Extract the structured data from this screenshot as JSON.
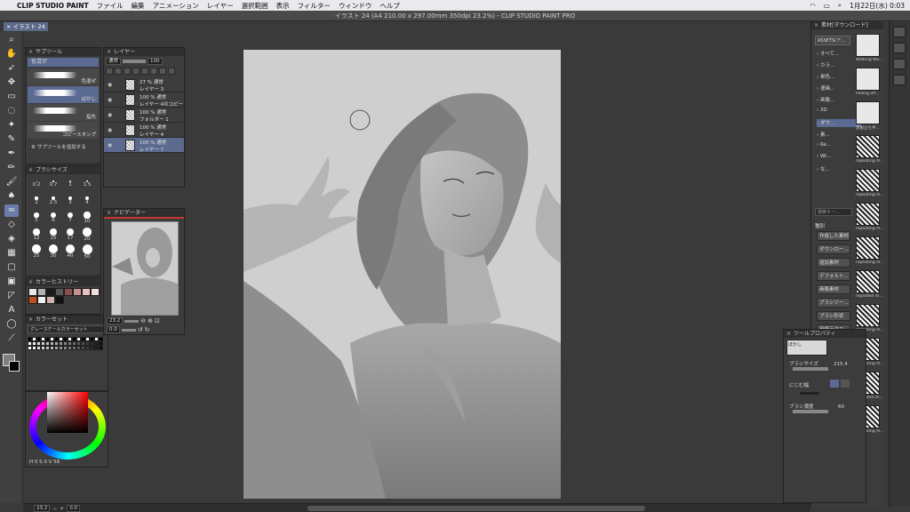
{
  "menubar": {
    "app_name": "CLIP STUDIO PAINT",
    "items": [
      "ファイル",
      "編集",
      "アニメーション",
      "レイヤー",
      "選択範囲",
      "表示",
      "フィルター",
      "ウィンドウ",
      "ヘルプ"
    ],
    "clock": "1月22日(水) 0:03"
  },
  "window": {
    "title": "イラスト 24 (A4 210.00 x 297.00mm 350dpi 23.2%) - CLIP STUDIO PAINT PRO",
    "canvas_tab": "イラスト 24"
  },
  "subtool_panel": {
    "title": "サブツール",
    "tab": "色混ぜ",
    "items": [
      "色混ぜ",
      "ぼかし",
      "指先",
      "コピースタンプ"
    ],
    "add_button": "サブツールを追加する"
  },
  "brushsize_panel": {
    "title": "ブラシサイズ",
    "sizes": [
      "0.2",
      "0.7",
      "1",
      "1.5",
      "2",
      "2.5",
      "3",
      "4",
      "5",
      "6",
      "7",
      "10",
      "12",
      "15",
      "17",
      "20",
      "25",
      "30",
      "40",
      "50"
    ]
  },
  "layer_panel": {
    "title": "レイヤー",
    "blend_mode": "通常",
    "opacity": "100",
    "layers": [
      {
        "mode": "27 % 通常",
        "name": "レイヤー 3"
      },
      {
        "mode": "100 % 通常",
        "name": "レイヤー 4のコピー"
      },
      {
        "mode": "100 % 通常",
        "name": "フォルダー 1"
      },
      {
        "mode": "100 % 通常",
        "name": "レイヤー 4"
      },
      {
        "mode": "100 % 通常",
        "name": "レイヤー 7"
      }
    ]
  },
  "navigator_panel": {
    "title": "ナビゲーター",
    "zoom": "23.2",
    "rotation": "0.0"
  },
  "colorhistory_panel": {
    "title": "カラーヒストリー",
    "colors": [
      "#e8e8e8",
      "#b0b0b0",
      "#1a1a1a",
      "#5a5a5a",
      "#8a5050",
      "#c89090",
      "#e8c0c0",
      "#f0e0e0",
      "#c05020",
      "#f0f0f0",
      "#d0b0b0",
      "#101010"
    ]
  },
  "colorset_panel": {
    "title": "カラーセット",
    "set_name": "グレースケールカラーセット"
  },
  "colorwheel": {
    "hue_value": "0",
    "sat_value": "0",
    "val_value": "58"
  },
  "material_panel": {
    "title": "素材[ダウンロード]",
    "header": "ASSETS(ア...",
    "tree": [
      "すべて...",
      "カラ...",
      "単色...",
      "漫画...",
      "画像...",
      "3D",
      "ダウ...",
      "素...",
      "Re...",
      "Wi...",
      "な..."
    ],
    "search_placeholder": "検索キー...",
    "tags_title": "種別",
    "tags": [
      "作成した素材",
      "ダウンロー...",
      "追加素材",
      "デフォルト...",
      "画像素材",
      "ブラシツー...",
      "ブラシ形状",
      "用紙テクス..."
    ],
    "thumbs": [
      "Walking Wo...",
      "Pulling off...",
      "黒服立ち手...",
      "repeating m...",
      "repeating m...",
      "repeating m...",
      "repeating m...",
      "repeated m...",
      "repeating m...",
      "repeating m...",
      "repeated m...",
      "repeating m..."
    ]
  },
  "toolprop_panel": {
    "title": "ツールプロパティ",
    "tool_name": "ぼかし",
    "brush_size_label": "ブラシサイズ",
    "brush_size_value": "215.4",
    "blur_label": "にじむ幅",
    "density_label": "ブラシ濃度",
    "density_value": "60"
  },
  "statusbar": {
    "zoom": "23.2",
    "angle": "0.0"
  }
}
